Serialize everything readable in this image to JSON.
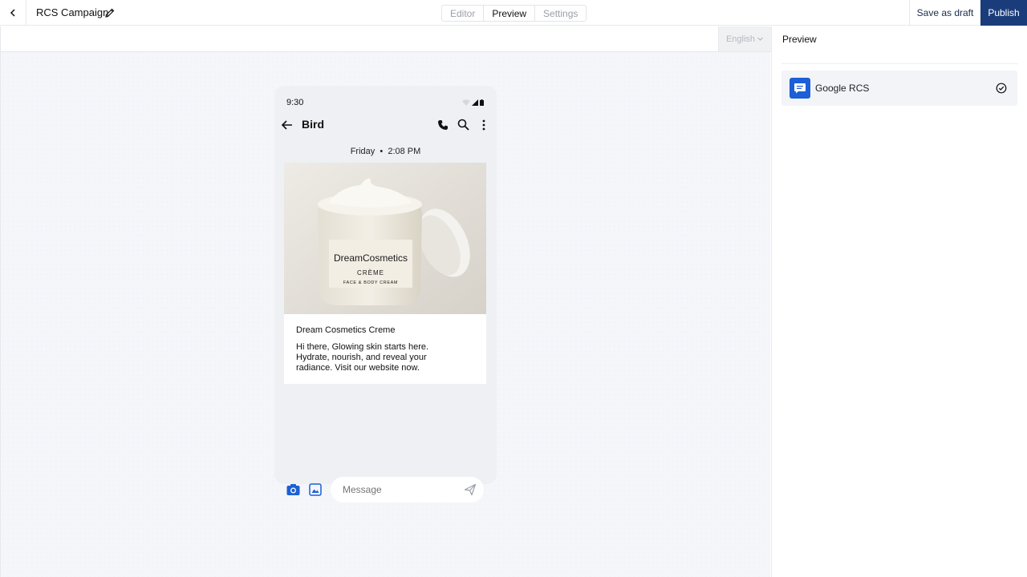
{
  "header": {
    "title": "RCS Campaign",
    "tabs": [
      {
        "label": "Editor",
        "active": false
      },
      {
        "label": "Preview",
        "active": true
      },
      {
        "label": "Settings",
        "active": false
      }
    ],
    "save_draft_label": "Save as draft",
    "publish_label": "Publish"
  },
  "canvas": {
    "language": "English"
  },
  "phone": {
    "time": "9:30",
    "contact": "Bird",
    "date": "Friday",
    "time_sent": "2:08 PM",
    "card": {
      "image_brand": "DreamCosmetics",
      "image_product": "CRÈME",
      "image_sub": "FACE & BODY CREAM",
      "title": "Dream Cosmetics Creme",
      "body": "Hi there, Glowing skin starts here. Hydrate, nourish, and reveal your radiance. Visit our website now."
    },
    "message_placeholder": "Message"
  },
  "right_panel": {
    "title": "Preview",
    "channel": "Google RCS"
  },
  "colors": {
    "accent": "#1a3c7a",
    "rcs_blue": "#1c5fd6"
  }
}
